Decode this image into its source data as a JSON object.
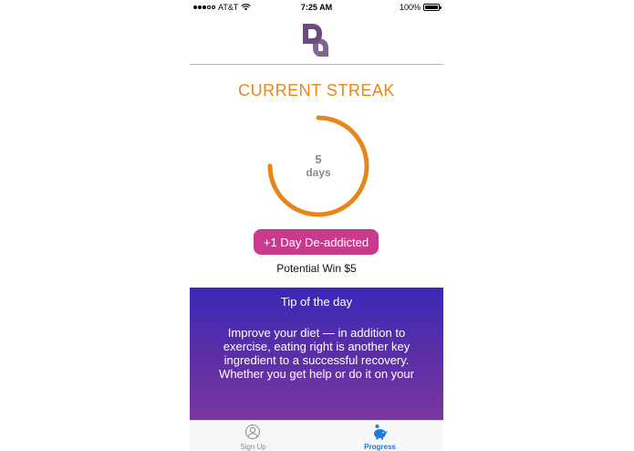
{
  "status_bar": {
    "carrier": "AT&T",
    "time": "7:25 AM",
    "battery_percent": "100%",
    "battery_level": 1.0,
    "signal_bars_filled": 3,
    "signal_bars_total": 5
  },
  "streak": {
    "title": "CURRENT STREAK",
    "count": "5",
    "unit": "days",
    "ring_color": "#e8861a",
    "ring_progress_fraction": 0.75
  },
  "action": {
    "button_label": "+1 Day De-addicted",
    "button_color": "#c93a8c"
  },
  "potential_win": "Potential Win $5",
  "tip": {
    "title": "Tip of the day",
    "body": "Improve your diet — in addition to exercise, eating right is another key ingredient to a successful recovery. Whether you get help or do it on your"
  },
  "tab_bar": {
    "tabs": [
      {
        "label": "Sign Up",
        "icon": "user-circle-icon",
        "active": false
      },
      {
        "label": "Progress",
        "icon": "piggy-bank-icon",
        "active": true
      }
    ],
    "active_color": "#1a7ae0"
  },
  "colors": {
    "logo": "#6b4a80",
    "title": "#e8861a"
  }
}
